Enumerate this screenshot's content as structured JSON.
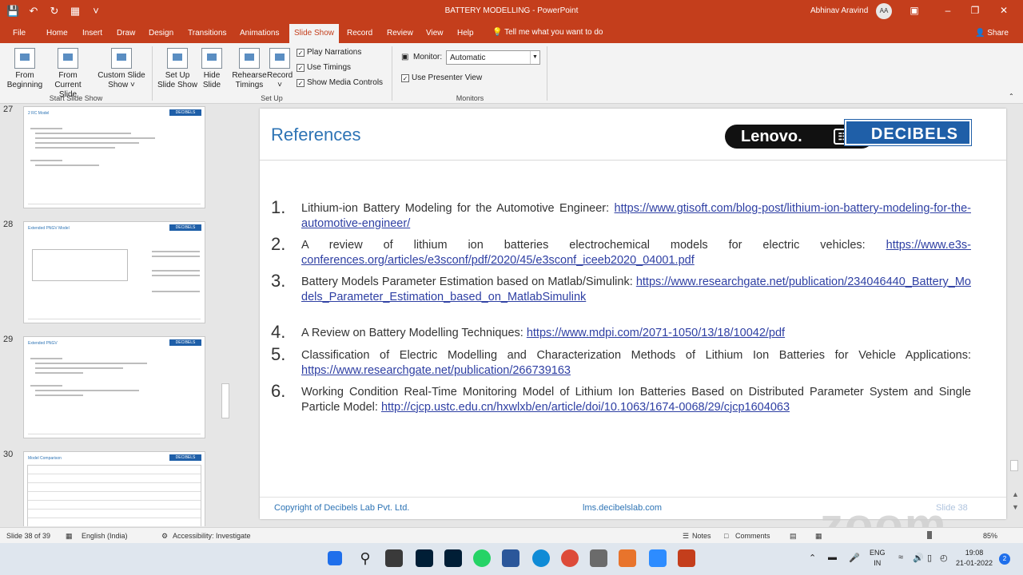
{
  "window": {
    "title": "BATTERY MODELLING  -  PowerPoint",
    "user": "Abhinav Aravind",
    "initials": "AA"
  },
  "tabs": [
    "File",
    "Home",
    "Insert",
    "Draw",
    "Design",
    "Transitions",
    "Animations",
    "Slide Show",
    "Record",
    "Review",
    "View",
    "Help"
  ],
  "tell_me": "Tell me what you want to do",
  "share": "Share",
  "ribbon": {
    "from_beginning": [
      "From",
      "Beginning"
    ],
    "from_current": [
      "From",
      "Current Slide"
    ],
    "custom_show": [
      "Custom Slide",
      "Show ˅"
    ],
    "group_start": "Start Slide Show",
    "setup_show": [
      "Set Up",
      "Slide Show"
    ],
    "hide_slide": [
      "Hide",
      "Slide"
    ],
    "rehearse": [
      "Rehearse",
      "Timings"
    ],
    "record": [
      "Record",
      "˅"
    ],
    "play_narrations": "Play Narrations",
    "use_timings": "Use Timings",
    "show_media_controls": "Show Media Controls",
    "group_setup": "Set Up",
    "monitor_label": "Monitor:",
    "monitor_value": "Automatic",
    "presenter_view": "Use Presenter View",
    "group_monitors": "Monitors"
  },
  "thumbnails": [
    {
      "num": "27",
      "title": "2 RC Model"
    },
    {
      "num": "28",
      "title": "Extended PNGV Model"
    },
    {
      "num": "29",
      "title": "Extended PNGV"
    },
    {
      "num": "30",
      "title": "Model Comparison"
    }
  ],
  "thumb_logo": "DECIBELS",
  "slide": {
    "title": "References",
    "lenovo": "Lenovo.",
    "decibels": "DECIBELS",
    "refs": [
      {
        "num": "1.",
        "text": "Lithium-ion Battery Modeling for the Automotive Engineer: ",
        "url": "https://www.gtisoft.com/blog-post/lithium-ion-battery-modeling-for-the-automotive-engineer/"
      },
      {
        "num": "2.",
        "text": "A review of lithium ion batteries electrochemical models for electric vehicles: ",
        "url": "https://www.e3s-conferences.org/articles/e3sconf/pdf/2020/45/e3sconf_iceeb2020_04001.pdf"
      },
      {
        "num": "3.",
        "text": "Battery Models Parameter Estimation based on Matlab/Simulink: ",
        "url": "https://www.researchgate.net/publication/234046440_Battery_Models_Parameter_Estimation_based_on_MatlabSimulink"
      },
      {
        "num": "4.",
        "text": "A Review on Battery Modelling Techniques: ",
        "url": "https://www.mdpi.com/2071-1050/13/18/10042/pdf"
      },
      {
        "num": "5.",
        "text": "Classification of Electric Modelling and Characterization Methods of Lithium Ion Batteries for Vehicle Applications: ",
        "url": "https://www.researchgate.net/publication/266739163"
      },
      {
        "num": "6.",
        "text": "Working Condition Real-Time Monitoring Model of Lithium Ion Batteries Based on Distributed Parameter System and Single Particle Model: ",
        "url": "http://cjcp.ustc.edu.cn/hxwlxb/en/article/doi/10.1063/1674-0068/29/cjcp1604063"
      }
    ],
    "footer_copy": "Copyright of Decibels Lab Pvt. Ltd.",
    "footer_site": "lms.decibelslab.com",
    "footer_num": "Slide 38"
  },
  "status": {
    "slide_info": "Slide 38 of 39",
    "language": "English (India)",
    "accessibility": "Accessibility: Investigate",
    "notes": "Notes",
    "comments": "Comments",
    "zoom": "85%"
  },
  "watermark": "zoom",
  "tray": {
    "lang1": "ENG",
    "lang2": "IN",
    "time": "19:08",
    "date": "21-01-2022",
    "notif": "2"
  }
}
